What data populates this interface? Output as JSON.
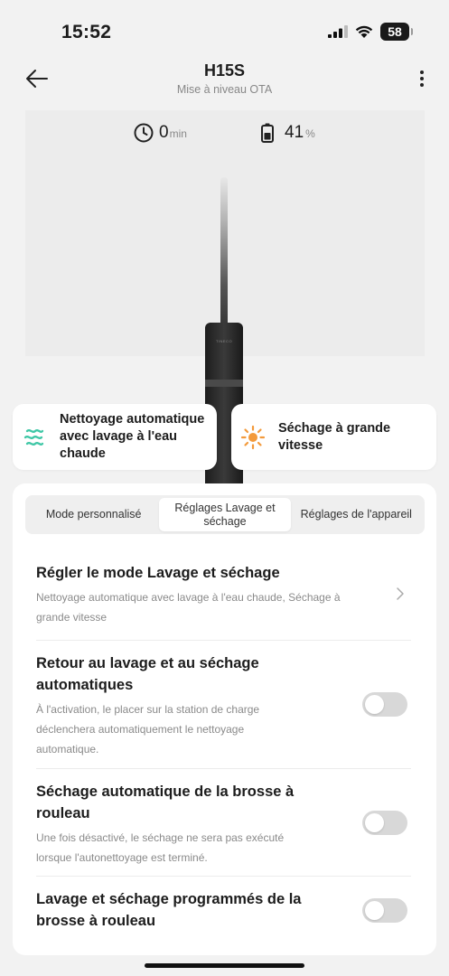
{
  "status_bar": {
    "time": "15:52",
    "battery": "58"
  },
  "header": {
    "title": "H15S",
    "subtitle": "Mise à niveau OTA"
  },
  "stats": {
    "duration": {
      "value": "0",
      "unit": "min"
    },
    "battery": {
      "value": "41",
      "unit": "%"
    }
  },
  "device_brand": "TINECO",
  "features": [
    {
      "label": "Nettoyage automatique avec lavage à l'eau chaude",
      "icon": "hot-water-wash-icon"
    },
    {
      "label": "Séchage à grande vitesse",
      "icon": "sun-dry-icon"
    }
  ],
  "tabs": [
    {
      "label": "Mode personnalisé",
      "active": false
    },
    {
      "label": "Réglages Lavage et séchage",
      "active": true
    },
    {
      "label": "Réglages de l'appareil",
      "active": false
    }
  ],
  "settings": [
    {
      "title": "Régler le mode Lavage et séchage",
      "desc": "Nettoyage automatique avec lavage à l'eau chaude, Séchage à grande vitesse",
      "control": "chevron"
    },
    {
      "title": "Retour au lavage et au séchage automatiques",
      "desc": "À l'activation, le placer sur la station de charge déclenchera automatiquement le nettoyage automatique.",
      "control": "toggle",
      "on": false
    },
    {
      "title": "Séchage automatique de la brosse à rouleau",
      "desc": "Une fois désactivé, le séchage ne sera pas exécuté lorsque l'autonettoyage est terminé.",
      "control": "toggle",
      "on": false
    },
    {
      "title": "Lavage et séchage programmés de la brosse à rouleau",
      "desc": "",
      "control": "toggle",
      "on": false
    }
  ],
  "colors": {
    "accent_teal": "#3fc7a6",
    "accent_orange": "#f39a3b",
    "toggle_off": "#d8d8d8"
  }
}
